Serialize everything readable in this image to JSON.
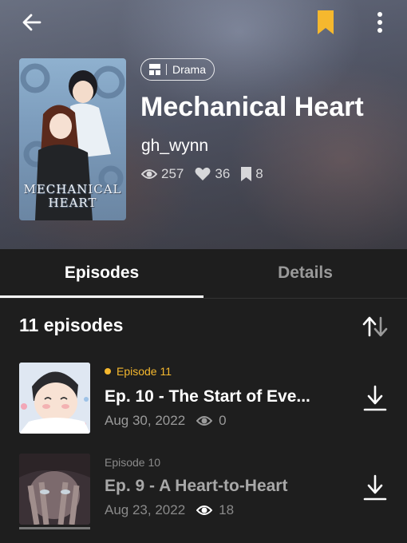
{
  "header": {
    "back_icon": "arrow-left-icon",
    "bookmark_icon": "bookmark-icon",
    "more_icon": "more-vertical-icon",
    "accent_color": "#f5b82e"
  },
  "series": {
    "cover_title": "MECHANICAL HEART",
    "genre": "Drama",
    "title": "Mechanical Heart",
    "author": "gh_wynn",
    "stats": {
      "views": "257",
      "likes": "36",
      "bookmarks": "8"
    }
  },
  "tabs": [
    {
      "label": "Episodes",
      "active": true
    },
    {
      "label": "Details",
      "active": false
    }
  ],
  "episodes_header": {
    "count_label": "11 episodes",
    "sort_icon": "sort-arrows-icon"
  },
  "episodes": [
    {
      "badge": "Episode 11",
      "is_new": true,
      "title": "Ep. 10 - The Start of Eve...",
      "date": "Aug 30, 2022",
      "views": "0"
    },
    {
      "badge": "Episode 10",
      "is_new": false,
      "title": "Ep. 9 - A Heart-to-Heart",
      "date": "Aug 23, 2022",
      "views": "18"
    }
  ]
}
